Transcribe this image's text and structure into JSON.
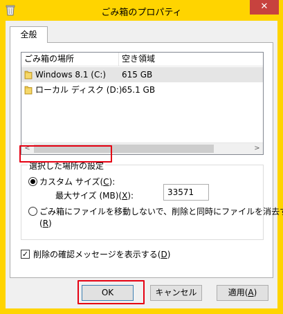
{
  "window": {
    "title": "ごみ箱のプロパティ",
    "close_glyph": "✕",
    "frame_color": "#ffd400",
    "close_color": "#c7423e",
    "highlight_color": "#e50012"
  },
  "tabs": [
    {
      "label": "全般",
      "selected": true
    }
  ],
  "listview": {
    "columns": [
      "ごみ箱の場所",
      "空き領域"
    ],
    "rows": [
      {
        "name": "Windows 8.1 (C:)",
        "space": "615 GB",
        "icon": "drive-folder-icon",
        "selected": true
      },
      {
        "name": "ローカル ディスク (D:)",
        "space": "65.1 GB",
        "icon": "drive-folder-icon",
        "selected": false
      }
    ],
    "scroll_left_glyph": "<",
    "scroll_right_glyph": ">"
  },
  "settings": {
    "group_label": "選択した場所の設定",
    "custom_size": {
      "label": "カスタム サイズ(",
      "accel": "C",
      "label_end": "):",
      "checked": true
    },
    "max_size": {
      "label": "最大サイズ (MB)(",
      "accel": "X",
      "label_end": "):",
      "value": "33571"
    },
    "delete_immediately": {
      "label": "ごみ箱にファイルを移動しないで、削除と同時にファイルを消去する",
      "line2_open": "(",
      "accel": "R",
      "line2_close": ")",
      "checked": false
    }
  },
  "confirm_delete": {
    "label": "削除の確認メッセージを表示する(",
    "accel": "D",
    "label_end": ")",
    "checked": true,
    "check_glyph": "✓"
  },
  "buttons": {
    "ok": "OK",
    "cancel": "キャンセル",
    "apply_label": "適用(",
    "apply_accel": "A",
    "apply_end": ")"
  }
}
